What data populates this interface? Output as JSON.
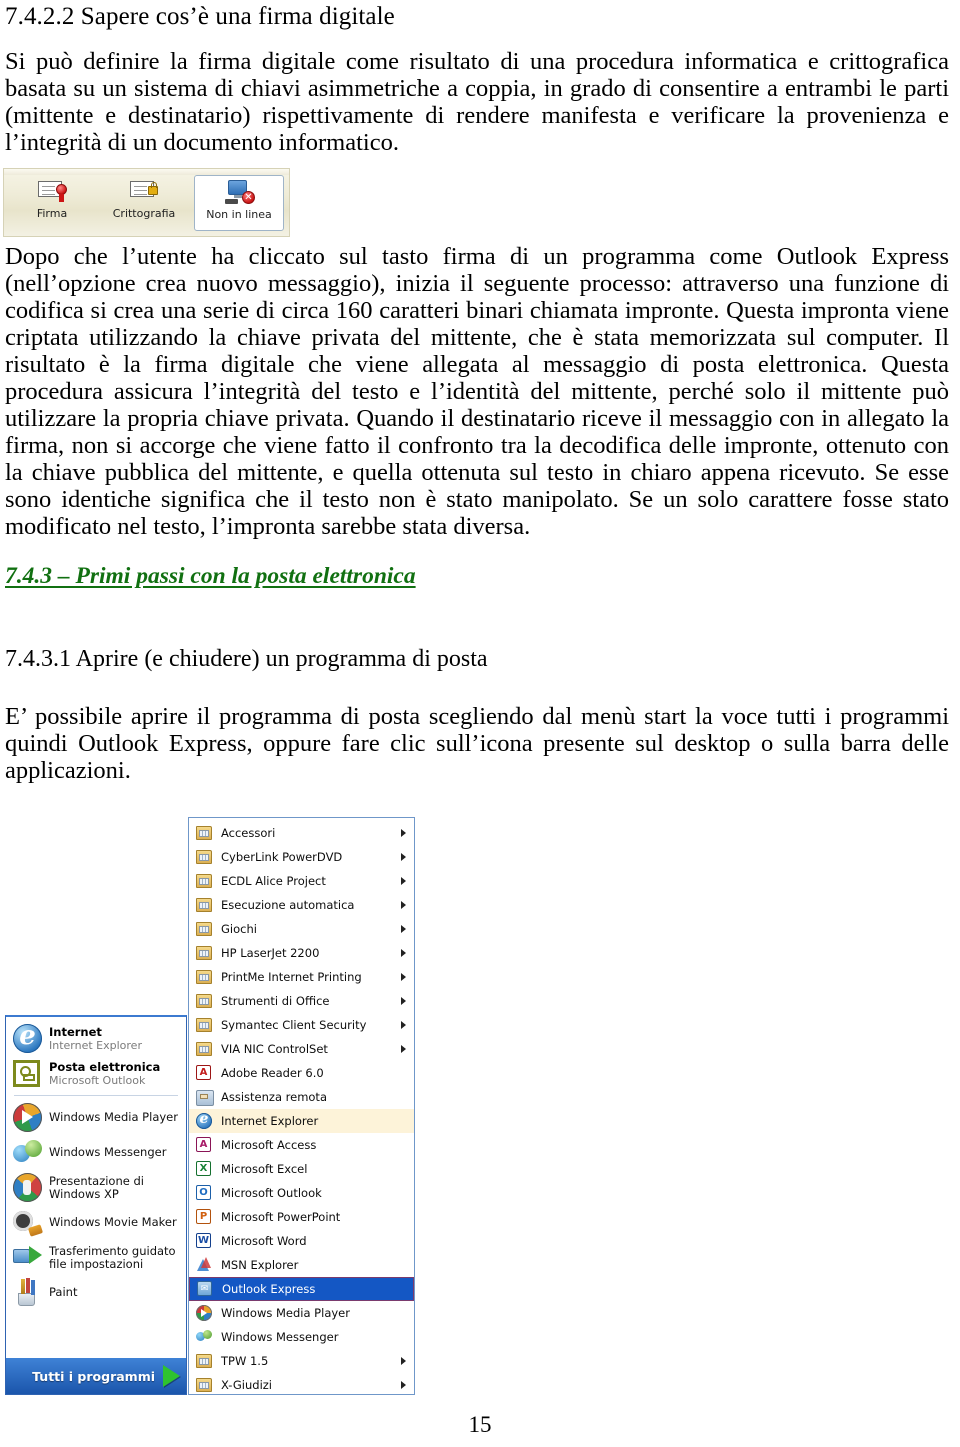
{
  "document": {
    "heading": "7.4.2.2 Sapere cos’è una firma digitale",
    "paragraph_1": "Si può definire la firma digitale come risultato di una procedura informatica e crittografica basata su un sistema di chiavi asimmetriche a coppia, in grado di consentire a entrambi le parti (mittente e destinatario) rispettivamente di rendere manifesta e verificare la provenienza e l’integrità di un documento informatico.",
    "paragraph_2": "Dopo che l’utente ha cliccato sul tasto firma di un programma come Outlook Express (nell’opzione crea nuovo messaggio), inizia il seguente processo: attraverso una funzione di codifica si crea una serie di circa 160 caratteri binari chiamata impronte. Questa impronta viene criptata utilizzando la chiave privata del mittente, che è stata memorizzata sul computer. Il risultato è la firma digitale che viene allegata al messaggio di posta elettronica. Questa procedura assicura l’integrità del testo e l’identità del mittente, perché solo il mittente può utilizzare la propria chiave privata. Quando il destinatario riceve il messaggio con in allegato la firma, non si accorge che viene fatto il confronto tra la decodifica delle impronte, ottenuto con la chiave pubblica del mittente, e quella ottenuta sul testo in chiaro appena ricevuto. Se esse sono identiche significa che il testo non è stato manipolato. Se un solo carattere fosse stato modificato nel testo, l’impronta sarebbe stata diversa.",
    "green_heading": "7.4.3 – Primi passi con la posta elettronica",
    "sub_heading": "7.4.3.1 Aprire (e chiudere) un programma di posta",
    "paragraph_3": "E’ possibile aprire il programma di posta scegliendo dal menù start la voce tutti i programmi quindi Outlook Express, oppure fare clic sull’icona presente sul desktop o sulla barra delle applicazioni.",
    "page_number": "15",
    "green_heading_color": "#117011"
  },
  "oe_toolbar": {
    "buttons": [
      {
        "label": "Firma",
        "icon": "signature-envelope-icon",
        "pressed": false
      },
      {
        "label": "Crittografia",
        "icon": "encrypted-envelope-icon",
        "pressed": false
      },
      {
        "label": "Non in linea",
        "icon": "offline-computer-icon",
        "pressed": true
      }
    ]
  },
  "start_menu": {
    "pinned": [
      {
        "title": "Internet",
        "subtitle": "Internet Explorer",
        "icon": "internet-explorer-icon"
      },
      {
        "title": "Posta elettronica",
        "subtitle": "Microsoft Outlook",
        "icon": "microsoft-outlook-icon"
      }
    ],
    "frequent": [
      {
        "title": "Windows Media Player",
        "icon": "windows-media-player-icon"
      },
      {
        "title": "Windows Messenger",
        "icon": "windows-messenger-icon"
      },
      {
        "title": "Presentazione di Windows XP",
        "icon": "windows-tour-icon"
      },
      {
        "title": "Windows Movie Maker",
        "icon": "windows-movie-maker-icon"
      },
      {
        "title": "Trasferimento guidato file impostazioni",
        "icon": "files-settings-transfer-icon"
      },
      {
        "title": "Paint",
        "icon": "paint-icon"
      }
    ],
    "all_programs_label": "Tutti i programmi",
    "programs": [
      {
        "label": "Accessori",
        "icon": "folder-icon",
        "submenu": true,
        "state": "normal"
      },
      {
        "label": "CyberLink PowerDVD",
        "icon": "folder-icon",
        "submenu": true,
        "state": "normal"
      },
      {
        "label": "ECDL Alice Project",
        "icon": "folder-icon",
        "submenu": true,
        "state": "normal"
      },
      {
        "label": "Esecuzione automatica",
        "icon": "folder-icon",
        "submenu": true,
        "state": "normal"
      },
      {
        "label": "Giochi",
        "icon": "folder-icon",
        "submenu": true,
        "state": "normal"
      },
      {
        "label": "HP LaserJet 2200",
        "icon": "folder-icon",
        "submenu": true,
        "state": "normal"
      },
      {
        "label": "PrintMe Internet Printing",
        "icon": "folder-icon",
        "submenu": true,
        "state": "normal"
      },
      {
        "label": "Strumenti di Office",
        "icon": "folder-icon",
        "submenu": true,
        "state": "normal"
      },
      {
        "label": "Symantec Client Security",
        "icon": "folder-icon",
        "submenu": true,
        "state": "normal"
      },
      {
        "label": "VIA NIC ControlSet",
        "icon": "folder-icon",
        "submenu": true,
        "state": "normal"
      },
      {
        "label": "Adobe Reader 6.0",
        "icon": "adobe-reader-icon",
        "submenu": false,
        "state": "normal"
      },
      {
        "label": "Assistenza remota",
        "icon": "remote-assistance-icon",
        "submenu": false,
        "state": "normal"
      },
      {
        "label": "Internet Explorer",
        "icon": "internet-explorer-icon",
        "submenu": false,
        "state": "recent"
      },
      {
        "label": "Microsoft Access",
        "icon": "microsoft-access-icon",
        "submenu": false,
        "state": "normal"
      },
      {
        "label": "Microsoft Excel",
        "icon": "microsoft-excel-icon",
        "submenu": false,
        "state": "normal"
      },
      {
        "label": "Microsoft Outlook",
        "icon": "microsoft-outlook-icon",
        "submenu": false,
        "state": "normal"
      },
      {
        "label": "Microsoft PowerPoint",
        "icon": "microsoft-powerpoint-icon",
        "submenu": false,
        "state": "normal"
      },
      {
        "label": "Microsoft Word",
        "icon": "microsoft-word-icon",
        "submenu": false,
        "state": "normal"
      },
      {
        "label": "MSN Explorer",
        "icon": "msn-explorer-icon",
        "submenu": false,
        "state": "normal"
      },
      {
        "label": "Outlook Express",
        "icon": "outlook-express-icon",
        "submenu": false,
        "state": "selected"
      },
      {
        "label": "Windows Media Player",
        "icon": "windows-media-player-icon",
        "submenu": false,
        "state": "normal"
      },
      {
        "label": "Windows Messenger",
        "icon": "windows-messenger-icon",
        "submenu": false,
        "state": "normal"
      },
      {
        "label": "TPW 1.5",
        "icon": "folder-icon",
        "submenu": true,
        "state": "normal"
      },
      {
        "label": "X-Giudizi",
        "icon": "folder-icon",
        "submenu": true,
        "state": "normal"
      }
    ],
    "selection_color": "#1457c4",
    "recent_color": "#fdf3d9"
  }
}
